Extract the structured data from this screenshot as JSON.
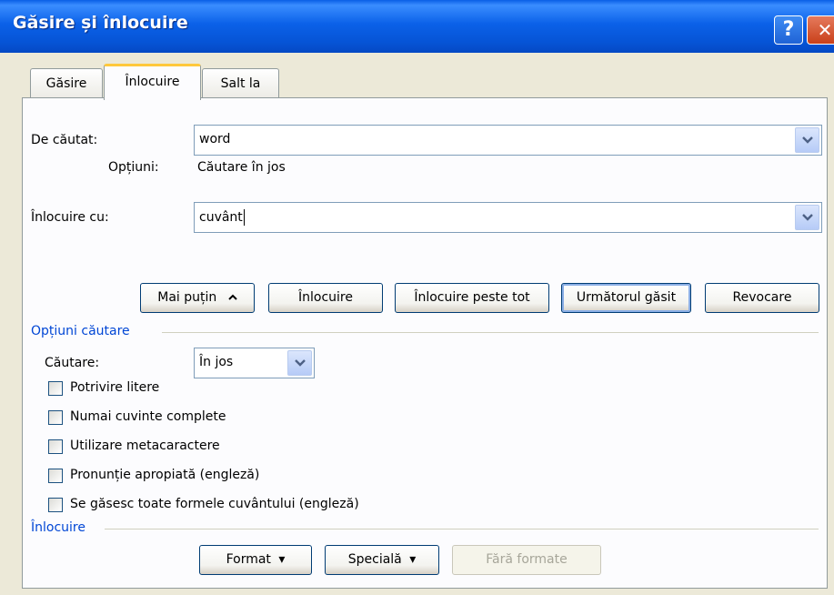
{
  "window": {
    "title": "Găsire și înlocuire",
    "help_glyph": "?",
    "close_glyph": "✕"
  },
  "tabs": [
    {
      "label": "Găsire",
      "active": false
    },
    {
      "label": "Înlocuire",
      "active": true
    },
    {
      "label": "Salt la",
      "active": false
    }
  ],
  "find": {
    "label": "De căutat:",
    "value": "word",
    "options_label": "Opțiuni:",
    "options_value": "Căutare în jos"
  },
  "replace": {
    "label": "Înlocuire cu:",
    "value": "cuvânt"
  },
  "buttons": {
    "less": "Mai puțin",
    "less_arrow": "⯭",
    "replace": "Înlocuire",
    "replace_all": "Înlocuire peste tot",
    "find_next": "Următorul găsit",
    "cancel": "Revocare"
  },
  "search_options": {
    "title": "Opțiuni căutare",
    "search_label": "Căutare:",
    "search_value": "În jos",
    "checkboxes": [
      {
        "label": "Potrivire litere",
        "checked": false
      },
      {
        "label": "Numai cuvinte complete",
        "checked": false
      },
      {
        "label": "Utilizare metacaractere",
        "checked": false
      },
      {
        "label": "Pronunție apropiată (engleză)",
        "checked": false
      },
      {
        "label": "Se găsesc toate formele cuvântului (engleză)",
        "checked": false
      }
    ]
  },
  "replace_section": {
    "title": "Înlocuire",
    "format": "Format",
    "special": "Specială",
    "no_formatting": "Fără formate",
    "dropdown_arrow": "▾"
  },
  "colors": {
    "titlebar": "#0a5fe6",
    "dialog_bg": "#ece9d8",
    "group_title": "#0046d5",
    "active_tab_accent": "#ffc83c"
  },
  "icons": [
    "help-icon",
    "close-icon",
    "chevron-down-icon",
    "chevron-up-icon",
    "triangle-down-icon"
  ]
}
